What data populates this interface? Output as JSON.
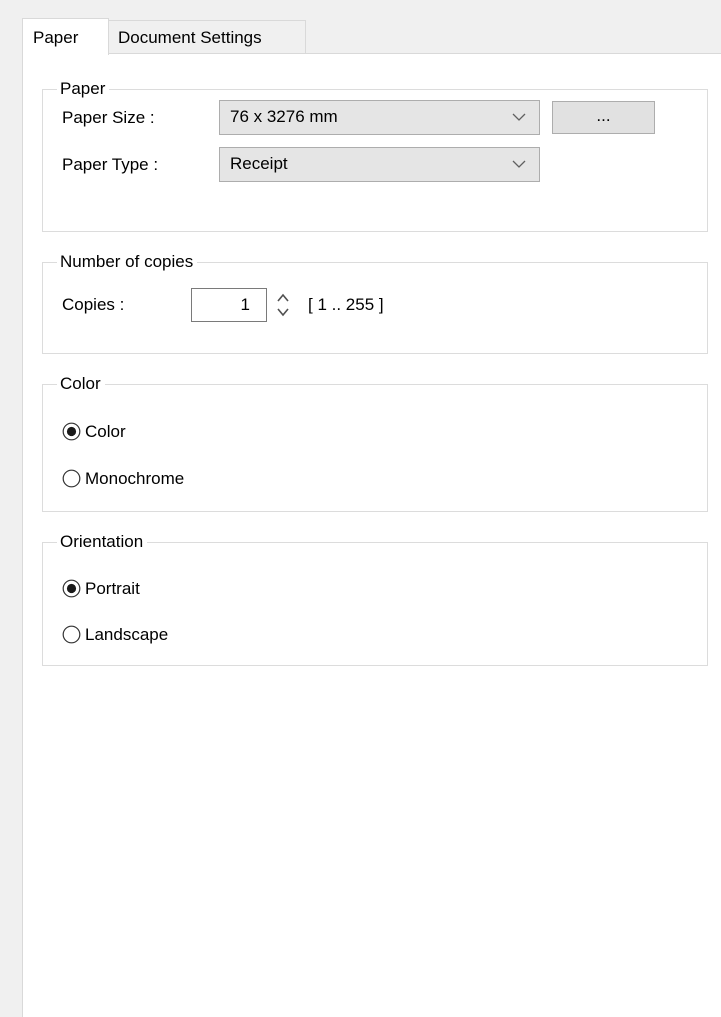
{
  "tabs": {
    "paper": "Paper",
    "document_settings": "Document Settings"
  },
  "paper_group": {
    "title": "Paper",
    "paper_size_label": "Paper Size :",
    "paper_size_value": "76 x 3276 mm",
    "browse_button_label": "...",
    "paper_type_label": "Paper Type :",
    "paper_type_value": "Receipt"
  },
  "copies_group": {
    "title": "Number of copies",
    "copies_label": "Copies :",
    "copies_value": "1",
    "range_hint": "[ 1 .. 255 ]"
  },
  "color_group": {
    "title": "Color",
    "options": [
      {
        "label": "Color",
        "selected": true
      },
      {
        "label": "Monochrome",
        "selected": false
      }
    ]
  },
  "orientation_group": {
    "title": "Orientation",
    "options": [
      {
        "label": "Portrait",
        "selected": true
      },
      {
        "label": "Landscape",
        "selected": false
      }
    ]
  }
}
